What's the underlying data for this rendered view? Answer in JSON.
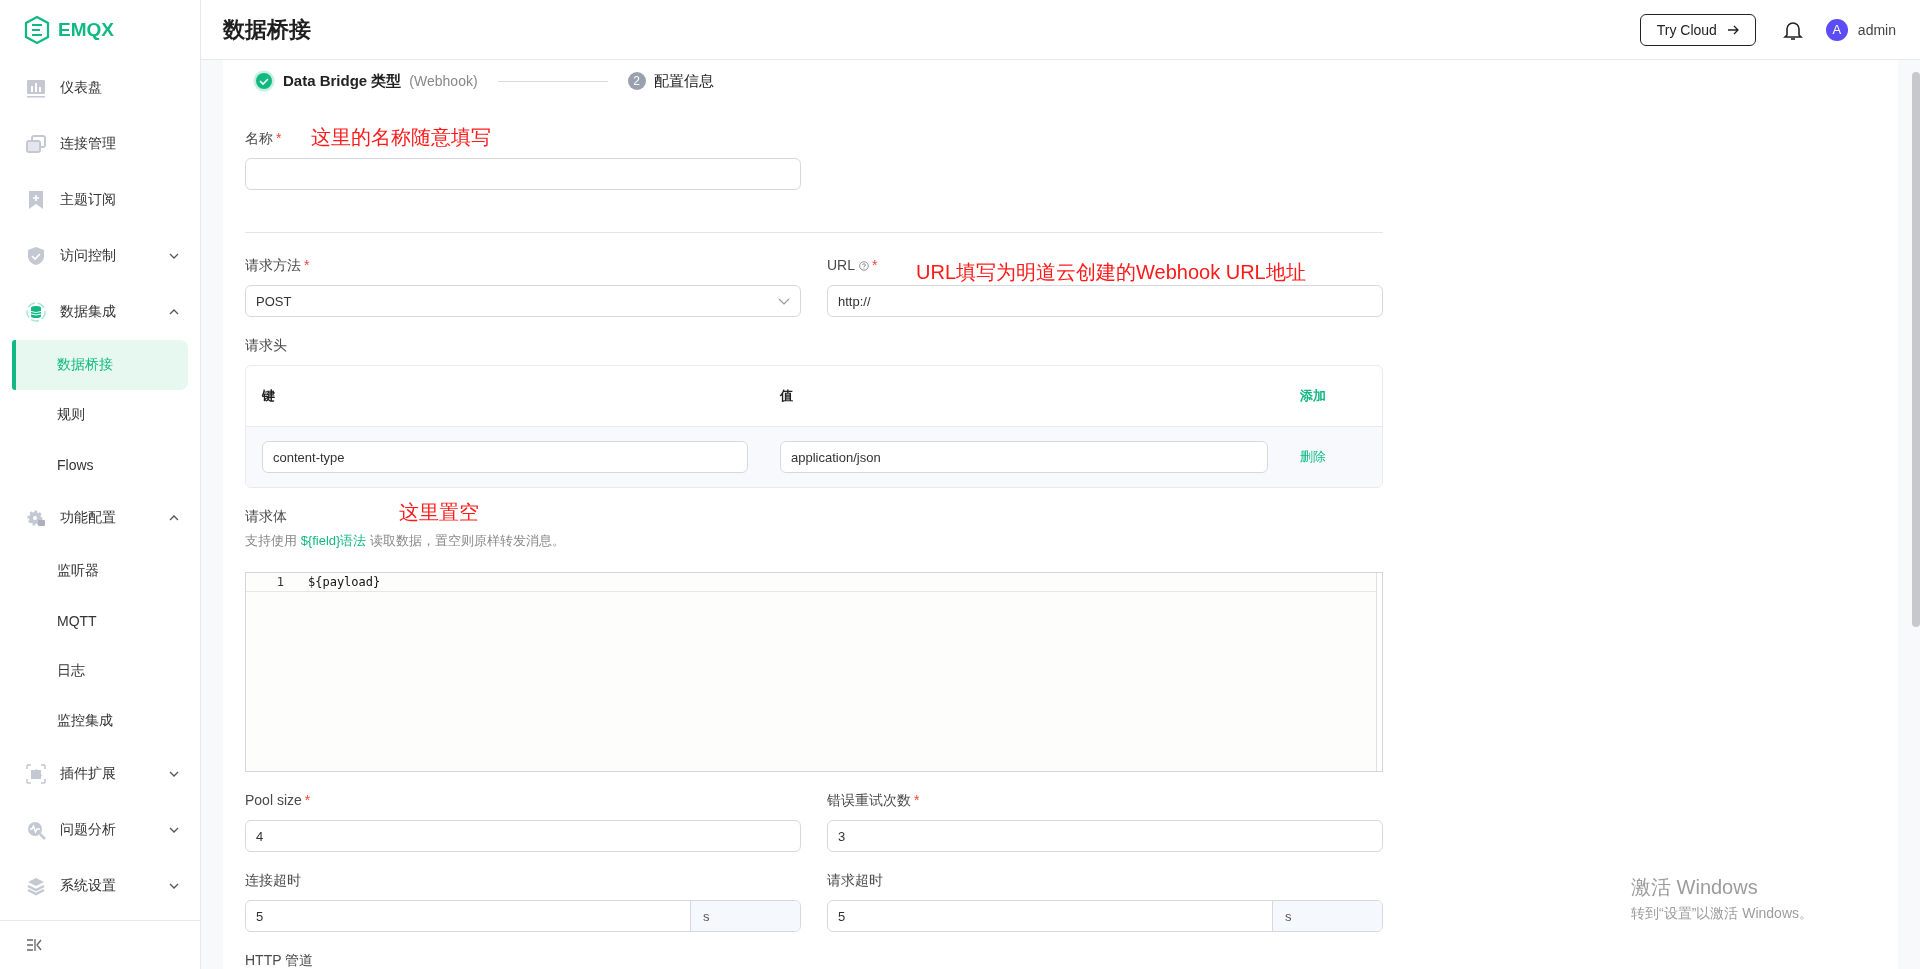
{
  "sidebar": {
    "logo": "EMQX",
    "items": [
      {
        "label": "仪表盘"
      },
      {
        "label": "连接管理"
      },
      {
        "label": "主题订阅"
      },
      {
        "label": "访问控制",
        "expanded": false
      },
      {
        "label": "数据集成",
        "expanded": true,
        "children": [
          {
            "label": "数据桥接",
            "selected": true
          },
          {
            "label": "规则",
            "selected": false
          },
          {
            "label": "Flows",
            "selected": false
          }
        ]
      },
      {
        "label": "功能配置",
        "expanded": true,
        "children": [
          {
            "label": "监听器",
            "selected": false
          },
          {
            "label": "MQTT",
            "selected": false
          },
          {
            "label": "日志",
            "selected": false
          },
          {
            "label": "监控集成",
            "selected": false
          }
        ]
      },
      {
        "label": "插件扩展",
        "expanded": false
      },
      {
        "label": "问题分析",
        "expanded": false
      },
      {
        "label": "系统设置",
        "expanded": false
      }
    ]
  },
  "header": {
    "title": "数据桥接",
    "try_cloud": "Try Cloud",
    "user": {
      "initial": "A",
      "name": "admin"
    }
  },
  "steps": [
    {
      "title": "Data Bridge 类型",
      "subtitle": "(Webhook)",
      "done": true
    },
    {
      "number": "2",
      "title": "配置信息",
      "done": false
    }
  ],
  "form": {
    "name": {
      "label": "名称",
      "required": "*"
    },
    "method": {
      "label": "请求方法",
      "required": "*",
      "value": "POST"
    },
    "url": {
      "label": "URL",
      "required": "*",
      "help": true,
      "value": "http://"
    },
    "headers": {
      "label": "请求头",
      "columns": [
        "键",
        "值"
      ],
      "add": "添加",
      "rows": [
        {
          "key": "content-type",
          "value": "application/json",
          "delete": "删除"
        }
      ]
    },
    "body": {
      "label": "请求体",
      "hint_before": "支持使用 ",
      "hint_link": "${field}语法",
      "hint_after": " 读取数据，置空则原样转发消息。",
      "lines": [
        {
          "number": "1",
          "code": "${payload}"
        }
      ]
    },
    "pool_size": {
      "label": "Pool size",
      "required": "*",
      "value": "4"
    },
    "retries": {
      "label": "错误重试次数",
      "required": "*",
      "value": "3"
    },
    "connect_timeout": {
      "label": "连接超时",
      "value": "5",
      "unit": "s"
    },
    "request_timeout": {
      "label": "请求超时",
      "value": "5",
      "unit": "s"
    },
    "http_pipeline": {
      "label": "HTTP 管道"
    }
  },
  "annotations": [
    {
      "text": "这里的名称随意填写"
    },
    {
      "text": "URL填写为明道云创建的Webhook URL地址"
    },
    {
      "text": "这里置空"
    }
  ],
  "os_notice": {
    "title": "激活 Windows",
    "subtitle": "转到“设置”以激活 Windows。"
  }
}
